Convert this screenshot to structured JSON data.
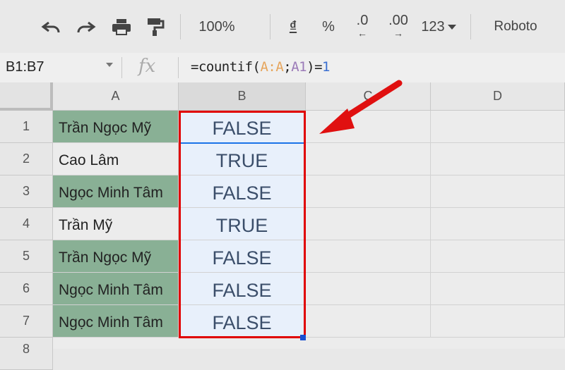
{
  "toolbar": {
    "zoom": "100%",
    "currency": "₫",
    "percent": "%",
    "decimal_decrease": ".0",
    "decimal_increase": ".00",
    "number_format": "123",
    "font": "Roboto"
  },
  "formula_bar": {
    "name_box": "B1:B7",
    "fx": "fx",
    "formula_prefix": "=countif(",
    "formula_range1": "A:A",
    "formula_sep": ";",
    "formula_range2": "A1",
    "formula_mid": ")=",
    "formula_num": "1"
  },
  "grid": {
    "columns": [
      "A",
      "B",
      "C",
      "D"
    ],
    "rows": [
      "1",
      "2",
      "3",
      "4",
      "5",
      "6",
      "7",
      "8"
    ],
    "colA": [
      "Trần Ngọc Mỹ",
      "Cao Lâm",
      "Ngọc Minh Tâm",
      "Trần Mỹ",
      "Trần Ngọc Mỹ",
      "Ngọc Minh Tâm",
      "Ngọc Minh Tâm"
    ],
    "colB": [
      "FALSE",
      "TRUE",
      "FALSE",
      "TRUE",
      "FALSE",
      "FALSE",
      "FALSE"
    ]
  },
  "colors": {
    "highlight_green": "#89b095",
    "selection_red": "#e00000",
    "arrow_red": "#e01010"
  }
}
